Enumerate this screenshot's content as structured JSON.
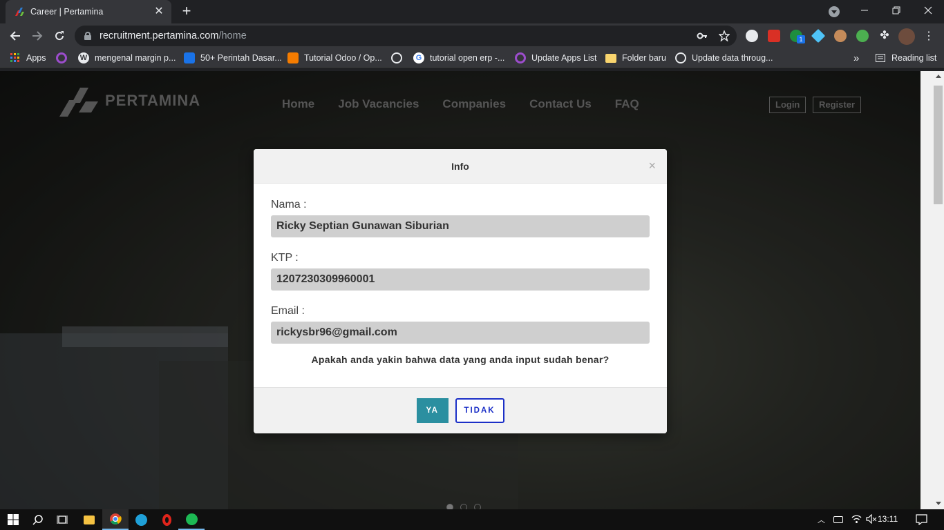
{
  "browser": {
    "tab": {
      "title": "Career | Pertamina"
    },
    "url": {
      "host": "recruitment.pertamina.com",
      "path": "/home"
    },
    "bookmarks": [
      {
        "label": "Apps",
        "icon": "apps-grid-icon"
      },
      {
        "label": "",
        "icon": "circle-ring-icon"
      },
      {
        "label": "mengenal margin p...",
        "icon": "wordpress-icon"
      },
      {
        "label": "50+ Perintah Dasar...",
        "icon": "trello-icon"
      },
      {
        "label": "Tutorial Odoo / Op...",
        "icon": "blogger-icon"
      },
      {
        "label": "",
        "icon": "globe-icon"
      },
      {
        "label": "tutorial open erp -...",
        "icon": "google-icon"
      },
      {
        "label": "Update Apps List",
        "icon": "circle-ring-icon"
      },
      {
        "label": "Folder baru",
        "icon": "folder-icon"
      },
      {
        "label": "Update data throug...",
        "icon": "globe-icon"
      }
    ],
    "more_bookmarks": "»",
    "reading_list": "Reading list",
    "extension_badge": "1"
  },
  "site": {
    "logo_text": "PERTAMINA",
    "nav": [
      "Home",
      "Job Vacancies",
      "Companies",
      "Contact Us",
      "FAQ"
    ],
    "login": "Login",
    "register": "Register"
  },
  "modal": {
    "title": "Info",
    "close": "×",
    "fields": [
      {
        "label": "Nama :",
        "value": "Ricky Septian Gunawan Siburian"
      },
      {
        "label": "KTP :",
        "value": "1207230309960001"
      },
      {
        "label": "Email :",
        "value": "rickysbr96@gmail.com"
      }
    ],
    "question": "Apakah anda yakin bahwa data yang anda input sudah benar?",
    "yes_label": "YA",
    "no_label": "TIDAK"
  },
  "taskbar": {
    "time": "13:11"
  },
  "colors": {
    "primary_button": "#2b8fa0",
    "secondary_button_border": "#1b2fc7",
    "browser_chrome": "#35363a"
  }
}
